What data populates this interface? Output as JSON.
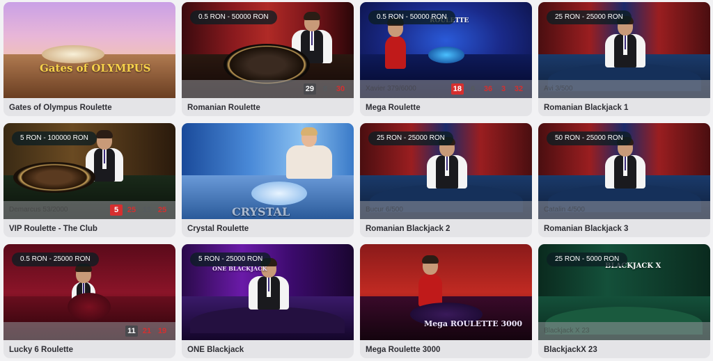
{
  "games": [
    {
      "title": "Gates of Olympus Roulette",
      "badge": "",
      "seats": "",
      "results": [],
      "logo": "Gates of OLYMPUS",
      "theme": "olympus"
    },
    {
      "title": "Romanian Roulette",
      "badge": "0.5 RON - 50000 RON",
      "seats": "",
      "results": [
        {
          "n": "29",
          "c": "black"
        },
        {
          "n": "8",
          "c": "black"
        },
        {
          "n": "30",
          "c": "red"
        }
      ],
      "logo": "",
      "theme": "roulette-red"
    },
    {
      "title": "Mega Roulette",
      "badge": "0.5 RON - 50000 RON",
      "seats": "Xavier 379/6000",
      "results": [
        {
          "n": "18",
          "c": "red"
        },
        {
          "n": "6",
          "c": "black"
        },
        {
          "n": "36",
          "c": "red"
        },
        {
          "n": "3",
          "c": "red"
        },
        {
          "n": "32",
          "c": "red"
        }
      ],
      "logo": "ROULETTE",
      "theme": "mega-blue"
    },
    {
      "title": "Romanian Blackjack 1",
      "badge": "25 RON - 25000 RON",
      "seats": "Avi 3/500",
      "results": [],
      "logo": "",
      "theme": "bj-red"
    },
    {
      "title": "VIP Roulette - The Club",
      "badge": "5 RON - 100000 RON",
      "seats": "Demarcus 53/2000",
      "results": [
        {
          "n": "5",
          "c": "red"
        },
        {
          "n": "25",
          "c": "red"
        },
        {
          "n": "15",
          "c": "black"
        },
        {
          "n": "25",
          "c": "red"
        }
      ],
      "logo": "",
      "theme": "vip"
    },
    {
      "title": "Crystal Roulette",
      "badge": "",
      "seats": "",
      "results": [],
      "logo": "CRYSTAL",
      "theme": "crystal"
    },
    {
      "title": "Romanian Blackjack 2",
      "badge": "25 RON - 25000 RON",
      "seats": "Bucur 6/500",
      "results": [],
      "logo": "",
      "theme": "bj-red"
    },
    {
      "title": "Romanian Blackjack 3",
      "badge": "50 RON - 25000 RON",
      "seats": "Catalin 4/500",
      "results": [],
      "logo": "",
      "theme": "bj-red"
    },
    {
      "title": "Lucky 6 Roulette",
      "badge": "0.5 RON - 25000 RON",
      "seats": "",
      "results": [
        {
          "n": "11",
          "c": "black"
        },
        {
          "n": "21",
          "c": "red"
        },
        {
          "n": "19",
          "c": "red"
        }
      ],
      "logo": "",
      "theme": "lucky"
    },
    {
      "title": "ONE Blackjack",
      "badge": "5 RON - 25000 RON",
      "seats": "",
      "results": [],
      "logo": "ONE BLACKJACK",
      "theme": "one-bj"
    },
    {
      "title": "Mega Roulette 3000",
      "badge": "",
      "seats": "",
      "results": [],
      "logo": "Mega ROULETTE 3000",
      "theme": "mega3000"
    },
    {
      "title": "BlackjackX 23",
      "badge": "25 RON - 5000 RON",
      "seats": "Blackjack X 23",
      "results": [],
      "logo": "BLACKJACK X",
      "theme": "bjx"
    }
  ],
  "colors": {
    "red": "#d62f2f",
    "black": "#4a4a4e",
    "green": "#2e9b45",
    "page_bg": "#f2f2f4",
    "card_bg": "#e4e4e7",
    "title_text": "#2d2d33"
  }
}
